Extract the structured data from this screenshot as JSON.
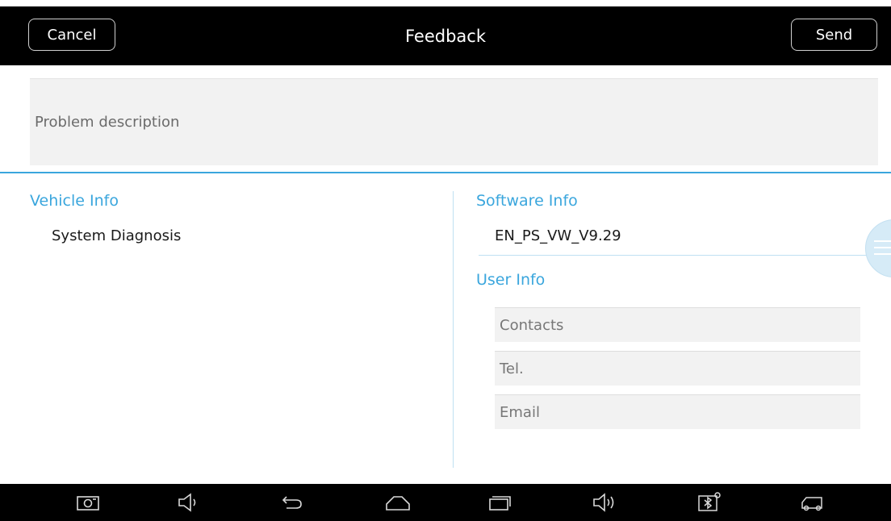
{
  "header": {
    "title": "Feedback",
    "cancel_label": "Cancel",
    "send_label": "Send"
  },
  "problem": {
    "placeholder": "Problem description"
  },
  "vehicle_info": {
    "title": "Vehicle Info",
    "value": "System Diagnosis"
  },
  "software_info": {
    "title": "Software Info",
    "value": "EN_PS_VW_V9.29"
  },
  "user_info": {
    "title": "User Info",
    "fields": [
      {
        "placeholder": "Contacts"
      },
      {
        "placeholder": "Tel."
      },
      {
        "placeholder": "Email"
      }
    ]
  },
  "navbar": {
    "icons": [
      "screenshot-icon",
      "volume-down-icon",
      "back-icon",
      "home-icon",
      "recent-apps-icon",
      "volume-up-icon",
      "bluetooth-settings-icon",
      "vehicle-icon"
    ]
  },
  "colors": {
    "accent": "#3aa6dd",
    "bar_background": "#000000",
    "field_background": "#f2f2f2"
  }
}
